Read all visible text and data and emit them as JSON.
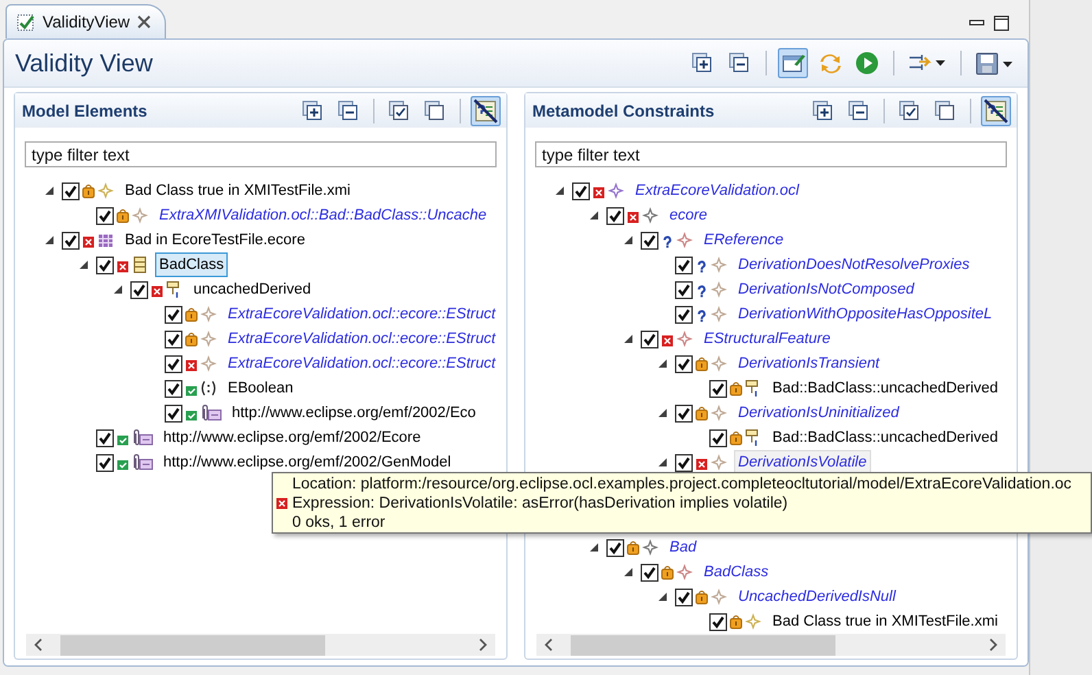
{
  "tab": {
    "title": "ValidityView",
    "selected": true
  },
  "view": {
    "title": "Validity View",
    "toolbar": [
      {
        "kind": "expand-all",
        "pressed": false
      },
      {
        "kind": "collapse-all",
        "pressed": false
      },
      {
        "kind": "separator"
      },
      {
        "kind": "edit-window",
        "pressed": true
      },
      {
        "kind": "refresh",
        "pressed": false
      },
      {
        "kind": "run",
        "pressed": false
      },
      {
        "kind": "separator"
      },
      {
        "kind": "filter-menu",
        "pressed": false
      },
      {
        "kind": "separator"
      },
      {
        "kind": "save-menu",
        "pressed": false
      }
    ]
  },
  "panes": [
    {
      "title": "Model Elements",
      "filter": {
        "placeholder": "type filter text"
      },
      "toolbar": [
        {
          "kind": "expand-all",
          "pressed": false
        },
        {
          "kind": "collapse-all",
          "pressed": false
        },
        {
          "kind": "separator"
        },
        {
          "kind": "check-all",
          "pressed": false
        },
        {
          "kind": "uncheck-all",
          "pressed": false
        },
        {
          "kind": "separator"
        },
        {
          "kind": "hide-filter",
          "pressed": true
        }
      ],
      "tree": [
        {
          "label": "Bad Class true in XMITestFile.xmi",
          "kind": "result",
          "status": {
            "kind": "warning"
          },
          "checked": true,
          "expanded": true,
          "selected": false,
          "hovered": false,
          "children": [
            {
              "label": "ExtraXMIValidation.ocl::Bad::BadClass::Uncache",
              "kind": "constraint",
              "status": {
                "kind": "warning"
              },
              "checked": true,
              "selected": false,
              "hovered": false
            }
          ]
        },
        {
          "label": "Bad in EcoreTestFile.ecore",
          "kind": "package",
          "status": {
            "kind": "error"
          },
          "checked": true,
          "expanded": true,
          "selected": false,
          "hovered": false,
          "children": [
            {
              "label": "BadClass",
              "kind": "class",
              "status": {
                "kind": "error"
              },
              "checked": true,
              "expanded": true,
              "selected": true,
              "hovered": false,
              "children": [
                {
                  "label": "uncachedDerived",
                  "kind": "attribute",
                  "status": {
                    "kind": "error"
                  },
                  "checked": true,
                  "expanded": true,
                  "selected": false,
                  "hovered": false,
                  "children": [
                    {
                      "label": "ExtraEcoreValidation.ocl::ecore::EStruct",
                      "kind": "constraint",
                      "status": {
                        "kind": "warning"
                      },
                      "checked": true,
                      "selected": false,
                      "hovered": false
                    },
                    {
                      "label": "ExtraEcoreValidation.ocl::ecore::EStruct",
                      "kind": "constraint",
                      "status": {
                        "kind": "warning"
                      },
                      "checked": true,
                      "selected": false,
                      "hovered": false
                    },
                    {
                      "label": "ExtraEcoreValidation.ocl::ecore::EStruct",
                      "kind": "constraint",
                      "status": {
                        "kind": "error"
                      },
                      "checked": true,
                      "selected": false,
                      "hovered": false
                    },
                    {
                      "label": "EBoolean",
                      "kind": "datatype",
                      "status": {
                        "kind": "ok"
                      },
                      "checked": true,
                      "selected": false,
                      "hovered": false
                    },
                    {
                      "label": "http://www.eclipse.org/emf/2002/Eco",
                      "kind": "annotation",
                      "status": {
                        "kind": "ok"
                      },
                      "checked": true,
                      "selected": false,
                      "hovered": false
                    }
                  ]
                }
              ]
            },
            {
              "label": "http://www.eclipse.org/emf/2002/Ecore",
              "kind": "annotation",
              "status": {
                "kind": "ok"
              },
              "checked": true,
              "selected": false,
              "hovered": false
            },
            {
              "label": "http://www.eclipse.org/emf/2002/GenModel",
              "kind": "annotation",
              "status": {
                "kind": "ok"
              },
              "checked": true,
              "selected": false,
              "hovered": false
            }
          ]
        }
      ]
    },
    {
      "title": "Metamodel Constraints",
      "filter": {
        "placeholder": "type filter text"
      },
      "toolbar": [
        {
          "kind": "expand-all",
          "pressed": false
        },
        {
          "kind": "collapse-all",
          "pressed": false
        },
        {
          "kind": "separator"
        },
        {
          "kind": "check-all",
          "pressed": false
        },
        {
          "kind": "uncheck-all",
          "pressed": false
        },
        {
          "kind": "separator"
        },
        {
          "kind": "hide-filter",
          "pressed": true
        }
      ],
      "tree": [
        {
          "label": "ExtraEcoreValidation.ocl",
          "kind": "ocl-file",
          "status": {
            "kind": "error"
          },
          "checked": true,
          "expanded": true,
          "selected": false,
          "hovered": false,
          "children": [
            {
              "label": "ecore",
              "kind": "ocl-package",
              "status": {
                "kind": "error"
              },
              "checked": true,
              "expanded": true,
              "selected": false,
              "hovered": false,
              "children": [
                {
                  "label": "EReference",
                  "kind": "ocl-class",
                  "status": {
                    "kind": "unknown"
                  },
                  "checked": true,
                  "expanded": true,
                  "selected": false,
                  "hovered": false,
                  "children": [
                    {
                      "label": "DerivationDoesNotResolveProxies",
                      "kind": "constraint",
                      "status": {
                        "kind": "unknown"
                      },
                      "checked": true,
                      "selected": false,
                      "hovered": false
                    },
                    {
                      "label": "DerivationIsNotComposed",
                      "kind": "constraint",
                      "status": {
                        "kind": "unknown"
                      },
                      "checked": true,
                      "selected": false,
                      "hovered": false
                    },
                    {
                      "label": "DerivationWithOppositeHasOppositeL",
                      "kind": "constraint",
                      "status": {
                        "kind": "unknown"
                      },
                      "checked": true,
                      "selected": false,
                      "hovered": false
                    }
                  ]
                },
                {
                  "label": "EStructuralFeature",
                  "kind": "ocl-class",
                  "status": {
                    "kind": "error"
                  },
                  "checked": true,
                  "expanded": true,
                  "selected": false,
                  "hovered": false,
                  "children": [
                    {
                      "label": "DerivationIsTransient",
                      "kind": "constraint",
                      "status": {
                        "kind": "warning"
                      },
                      "checked": true,
                      "expanded": true,
                      "selected": false,
                      "hovered": false,
                      "children": [
                        {
                          "label": "Bad::BadClass::uncachedDerived",
                          "kind": "attribute",
                          "status": {
                            "kind": "warning"
                          },
                          "checked": true,
                          "selected": false,
                          "hovered": false
                        }
                      ]
                    },
                    {
                      "label": "DerivationIsUninitialized",
                      "kind": "constraint",
                      "status": {
                        "kind": "warning"
                      },
                      "checked": true,
                      "expanded": true,
                      "selected": false,
                      "hovered": false,
                      "children": [
                        {
                          "label": "Bad::BadClass::uncachedDerived",
                          "kind": "attribute",
                          "status": {
                            "kind": "warning"
                          },
                          "checked": true,
                          "selected": false,
                          "hovered": false
                        }
                      ]
                    },
                    {
                      "label": "DerivationIsVolatile",
                      "kind": "constraint",
                      "status": {
                        "kind": "error"
                      },
                      "checked": true,
                      "expanded": true,
                      "selected": false,
                      "hovered": true
                    }
                  ]
                }
              ]
            },
            {
              "label": "Bad",
              "kind": "ocl-package",
              "status": {
                "kind": "warning"
              },
              "checked": true,
              "expanded": true,
              "selected": false,
              "hovered": false,
              "children": [
                {
                  "label": "BadClass",
                  "kind": "ocl-class",
                  "status": {
                    "kind": "warning"
                  },
                  "checked": true,
                  "expanded": true,
                  "selected": false,
                  "hovered": false,
                  "children": [
                    {
                      "label": "UncachedDerivedIsNull",
                      "kind": "constraint",
                      "status": {
                        "kind": "warning"
                      },
                      "checked": true,
                      "expanded": true,
                      "selected": false,
                      "hovered": false,
                      "children": [
                        {
                          "label": "Bad Class true in XMITestFile.xmi",
                          "kind": "result",
                          "status": {
                            "kind": "warning"
                          },
                          "checked": true,
                          "selected": false,
                          "hovered": false
                        }
                      ]
                    }
                  ]
                }
              ]
            }
          ]
        }
      ]
    }
  ],
  "tooltip": {
    "lines": [
      {
        "text": "Location: platform:/resource/org.eclipse.ocl.examples.project.completeocltutorial/model/ExtraEcoreValidation.oc",
        "kind": "plain"
      },
      {
        "text": "Expression: DerivationIsVolatile: asError(hasDerivation implies volatile)",
        "kind": "error"
      },
      {
        "text": "0 oks, 1 error",
        "kind": "plain"
      }
    ]
  }
}
